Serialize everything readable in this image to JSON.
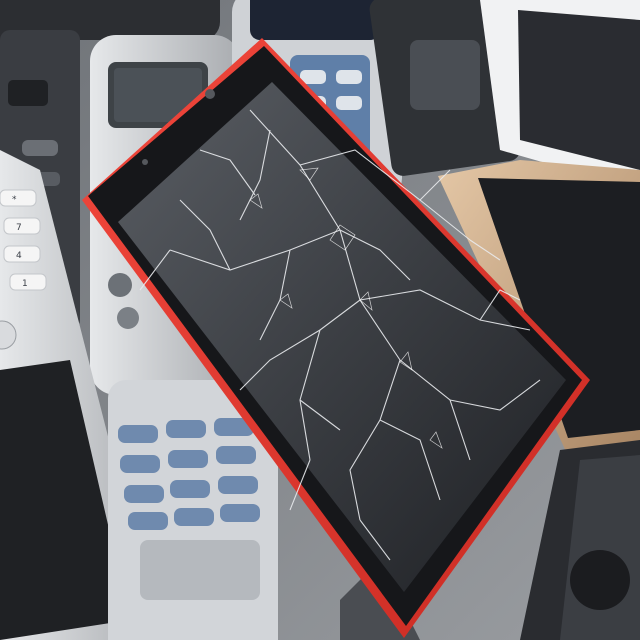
{
  "scene": {
    "description_icons": {
      "main_phone": "cracked-smartphone-icon",
      "background_phones": "old-mobile-phone-icon",
      "tablet": "tablet-icon"
    },
    "colors": {
      "background": "#8a8d90",
      "red_case": "#e8392f",
      "screen": "#2b2d31",
      "keypad_blue": "#5f7fa8",
      "silver": "#c8cacd",
      "gold": "#c9a27a"
    },
    "keypad_labels": {
      "k1": "*",
      "k2": "7",
      "k3": "4",
      "k4": "1"
    }
  }
}
